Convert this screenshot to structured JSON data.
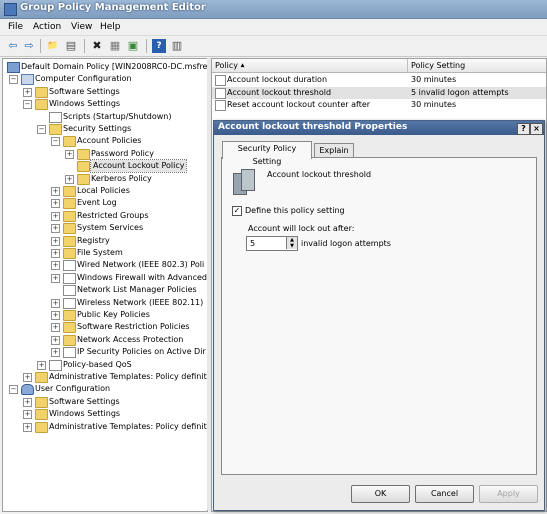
{
  "window": {
    "title": "Group Policy Management Editor"
  },
  "menu": [
    "File",
    "Action",
    "View",
    "Help"
  ],
  "toolbar": {
    "icons": [
      "back-arrow-icon",
      "forward-arrow-icon",
      "up-folder-icon",
      "show-hide-tree-icon",
      "delete-icon",
      "properties-icon",
      "export-list-icon",
      "help-icon",
      "view-icon"
    ],
    "glyphs": {
      "back": "⇦",
      "fwd": "⇨",
      "up": "📁",
      "tree": "▤",
      "del": "✖",
      "props": "▦",
      "export": "▣",
      "help": "?",
      "view": "▥"
    }
  },
  "tree": [
    {
      "label": "Default Domain Policy [WIN2008RC0-DC.msfree",
      "indent": 0,
      "exp": "",
      "icon": "pol"
    },
    {
      "label": "Computer Configuration",
      "indent": 1,
      "exp": "−",
      "icon": "comp"
    },
    {
      "label": "Software Settings",
      "indent": 2,
      "exp": "+",
      "icon": "folder"
    },
    {
      "label": "Windows Settings",
      "indent": 2,
      "exp": "−",
      "icon": "folder"
    },
    {
      "label": "Scripts (Startup/Shutdown)",
      "indent": 3,
      "exp": "",
      "icon": "doc"
    },
    {
      "label": "Security Settings",
      "indent": 3,
      "exp": "−",
      "icon": "folder"
    },
    {
      "label": "Account Policies",
      "indent": 4,
      "exp": "−",
      "icon": "folder"
    },
    {
      "label": "Password Policy",
      "indent": 5,
      "exp": "+",
      "icon": "folder"
    },
    {
      "label": "Account Lockout Policy",
      "indent": 5,
      "exp": "",
      "icon": "folder",
      "selected": true
    },
    {
      "label": "Kerberos Policy",
      "indent": 5,
      "exp": "+",
      "icon": "folder"
    },
    {
      "label": "Local Policies",
      "indent": 4,
      "exp": "+",
      "icon": "folder"
    },
    {
      "label": "Event Log",
      "indent": 4,
      "exp": "+",
      "icon": "folder"
    },
    {
      "label": "Restricted Groups",
      "indent": 4,
      "exp": "+",
      "icon": "folder"
    },
    {
      "label": "System Services",
      "indent": 4,
      "exp": "+",
      "icon": "folder"
    },
    {
      "label": "Registry",
      "indent": 4,
      "exp": "+",
      "icon": "folder"
    },
    {
      "label": "File System",
      "indent": 4,
      "exp": "+",
      "icon": "folder"
    },
    {
      "label": "Wired Network (IEEE 802.3) Poli",
      "indent": 4,
      "exp": "+",
      "icon": "doc"
    },
    {
      "label": "Windows Firewall with Advanced",
      "indent": 4,
      "exp": "+",
      "icon": "doc"
    },
    {
      "label": "Network List Manager Policies",
      "indent": 4,
      "exp": "",
      "icon": "doc"
    },
    {
      "label": "Wireless Network (IEEE 802.11)",
      "indent": 4,
      "exp": "+",
      "icon": "doc"
    },
    {
      "label": "Public Key Policies",
      "indent": 4,
      "exp": "+",
      "icon": "folder"
    },
    {
      "label": "Software Restriction Policies",
      "indent": 4,
      "exp": "+",
      "icon": "folder"
    },
    {
      "label": "Network Access Protection",
      "indent": 4,
      "exp": "+",
      "icon": "folder"
    },
    {
      "label": "IP Security Policies on Active Dir",
      "indent": 4,
      "exp": "+",
      "icon": "doc"
    },
    {
      "label": "Policy-based QoS",
      "indent": 3,
      "exp": "+",
      "icon": "doc"
    },
    {
      "label": "Administrative Templates: Policy definiti",
      "indent": 2,
      "exp": "+",
      "icon": "folder"
    },
    {
      "label": "User Configuration",
      "indent": 1,
      "exp": "−",
      "icon": "user"
    },
    {
      "label": "Software Settings",
      "indent": 2,
      "exp": "+",
      "icon": "folder"
    },
    {
      "label": "Windows Settings",
      "indent": 2,
      "exp": "+",
      "icon": "folder"
    },
    {
      "label": "Administrative Templates: Policy definiti",
      "indent": 2,
      "exp": "+",
      "icon": "folder"
    }
  ],
  "list": {
    "columns": [
      "Policy",
      "Policy Setting"
    ],
    "sort_glyph": "▲",
    "rows": [
      {
        "policy": "Account lockout duration",
        "setting": "30 minutes"
      },
      {
        "policy": "Account lockout threshold",
        "setting": "5 invalid logon attempts",
        "selected": true
      },
      {
        "policy": "Reset account lockout counter after",
        "setting": "30 minutes"
      }
    ]
  },
  "dialog": {
    "title": "Account lockout threshold Properties",
    "help_glyph": "?",
    "close_glyph": "×",
    "tabs": [
      "Security Policy Setting",
      "Explain"
    ],
    "policy_name": "Account lockout threshold",
    "define_checked": true,
    "check_glyph": "✓",
    "define_label": "Define this policy setting",
    "lockout_label": "Account will lock out after:",
    "lockout_value": "5",
    "lockout_unit": "invalid logon attempts",
    "spin_up": "▲",
    "spin_down": "▼",
    "buttons": {
      "ok": "OK",
      "cancel": "Cancel",
      "apply": "Apply"
    }
  }
}
